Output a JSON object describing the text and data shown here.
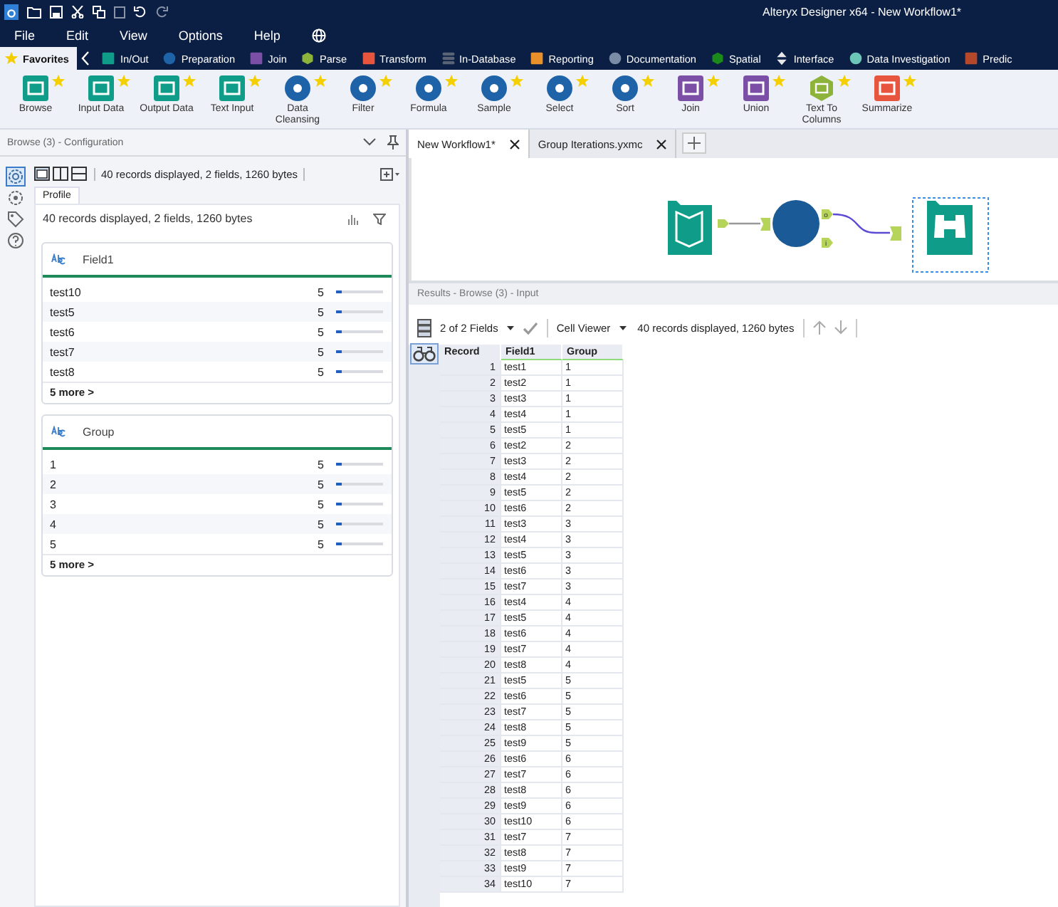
{
  "window": {
    "title": "Alteryx Designer x64 - New Workflow1*"
  },
  "menu": [
    "File",
    "Edit",
    "View",
    "Options",
    "Help"
  ],
  "categories": [
    {
      "label": "Favorites",
      "kind": "star",
      "color": "#f5cc00",
      "selected": true
    },
    {
      "label": "In/Out",
      "kind": "square",
      "color": "#0f9d8a",
      "selected": false
    },
    {
      "label": "Preparation",
      "kind": "circle",
      "color": "#1e63a8",
      "selected": false
    },
    {
      "label": "Join",
      "kind": "square",
      "color": "#7b4fa6",
      "selected": false
    },
    {
      "label": "Parse",
      "kind": "hexagon",
      "color": "#8db33a",
      "selected": false
    },
    {
      "label": "Transform",
      "kind": "square",
      "color": "#e8553e",
      "selected": false
    },
    {
      "label": "In-Database",
      "kind": "stack",
      "color": "#5a6375",
      "selected": false
    },
    {
      "label": "Reporting",
      "kind": "square",
      "color": "#e8902a",
      "selected": false
    },
    {
      "label": "Documentation",
      "kind": "circle",
      "color": "#7a8ba6",
      "selected": false
    },
    {
      "label": "Spatial",
      "kind": "hexagon",
      "color": "#1a8a1a",
      "selected": false
    },
    {
      "label": "Interface",
      "kind": "diamond",
      "color": "#e8e8e8",
      "selected": false
    },
    {
      "label": "Data Investigation",
      "kind": "circle",
      "color": "#6cc6b8",
      "selected": false
    },
    {
      "label": "Predic",
      "kind": "square",
      "color": "#b5482a",
      "selected": false
    }
  ],
  "tools": [
    {
      "label": "Browse",
      "kind": "square",
      "color": "#0f9d8a"
    },
    {
      "label": "Input Data",
      "kind": "square",
      "color": "#0f9d8a"
    },
    {
      "label": "Output Data",
      "kind": "square",
      "color": "#0f9d8a"
    },
    {
      "label": "Text Input",
      "kind": "square",
      "color": "#0f9d8a"
    },
    {
      "label": "Data Cleansing",
      "kind": "circle",
      "color": "#1e63a8"
    },
    {
      "label": "Filter",
      "kind": "circle",
      "color": "#1e63a8"
    },
    {
      "label": "Formula",
      "kind": "circle",
      "color": "#1e63a8"
    },
    {
      "label": "Sample",
      "kind": "circle",
      "color": "#1e63a8"
    },
    {
      "label": "Select",
      "kind": "circle",
      "color": "#1e63a8"
    },
    {
      "label": "Sort",
      "kind": "circle",
      "color": "#1e63a8"
    },
    {
      "label": "Join",
      "kind": "square",
      "color": "#7b4fa6"
    },
    {
      "label": "Union",
      "kind": "square",
      "color": "#7b4fa6"
    },
    {
      "label": "Text To Columns",
      "kind": "hexagon",
      "color": "#8db33a"
    },
    {
      "label": "Summarize",
      "kind": "square",
      "color": "#e8553e"
    }
  ],
  "config": {
    "title": "Browse (3) - Configuration",
    "toolbar_info": "40 records displayed, 2 fields, 1260 bytes",
    "tab": "Profile",
    "summary": "40 records displayed, 2 fields, 1260 bytes",
    "fields": [
      {
        "name": "Field1",
        "values": [
          {
            "value": "test10",
            "count": "5",
            "level": 0.125
          },
          {
            "value": "test5",
            "count": "5",
            "level": 0.125
          },
          {
            "value": "test6",
            "count": "5",
            "level": 0.125
          },
          {
            "value": "test7",
            "count": "5",
            "level": 0.125
          },
          {
            "value": "test8",
            "count": "5",
            "level": 0.125
          }
        ],
        "more": "5 more >"
      },
      {
        "name": "Group",
        "values": [
          {
            "value": "1",
            "count": "5",
            "level": 0.125
          },
          {
            "value": "2",
            "count": "5",
            "level": 0.125
          },
          {
            "value": "3",
            "count": "5",
            "level": 0.125
          },
          {
            "value": "4",
            "count": "5",
            "level": 0.125
          },
          {
            "value": "5",
            "count": "5",
            "level": 0.125
          }
        ],
        "more": "5 more >"
      }
    ]
  },
  "doc_tabs": [
    {
      "label": "New Workflow1*",
      "selected": true
    },
    {
      "label": "Group Iterations.yxmc",
      "selected": false
    }
  ],
  "canvas": {
    "anchors": [
      "o",
      "i"
    ],
    "browse_selected": true
  },
  "results": {
    "title": "Results - Browse (3) - Input",
    "fields": "2 of 2 Fields",
    "viewer": "Cell Viewer",
    "info": "40 records displayed, 1260 bytes",
    "columns": [
      "Record",
      "Field1",
      "Group"
    ],
    "rows": [
      [
        "1",
        "test1",
        "1"
      ],
      [
        "2",
        "test2",
        "1"
      ],
      [
        "3",
        "test3",
        "1"
      ],
      [
        "4",
        "test4",
        "1"
      ],
      [
        "5",
        "test5",
        "1"
      ],
      [
        "6",
        "test2",
        "2"
      ],
      [
        "7",
        "test3",
        "2"
      ],
      [
        "8",
        "test4",
        "2"
      ],
      [
        "9",
        "test5",
        "2"
      ],
      [
        "10",
        "test6",
        "2"
      ],
      [
        "11",
        "test3",
        "3"
      ],
      [
        "12",
        "test4",
        "3"
      ],
      [
        "13",
        "test5",
        "3"
      ],
      [
        "14",
        "test6",
        "3"
      ],
      [
        "15",
        "test7",
        "3"
      ],
      [
        "16",
        "test4",
        "4"
      ],
      [
        "17",
        "test5",
        "4"
      ],
      [
        "18",
        "test6",
        "4"
      ],
      [
        "19",
        "test7",
        "4"
      ],
      [
        "20",
        "test8",
        "4"
      ],
      [
        "21",
        "test5",
        "5"
      ],
      [
        "22",
        "test6",
        "5"
      ],
      [
        "23",
        "test7",
        "5"
      ],
      [
        "24",
        "test8",
        "5"
      ],
      [
        "25",
        "test9",
        "5"
      ],
      [
        "26",
        "test6",
        "6"
      ],
      [
        "27",
        "test7",
        "6"
      ],
      [
        "28",
        "test8",
        "6"
      ],
      [
        "29",
        "test9",
        "6"
      ],
      [
        "30",
        "test10",
        "6"
      ],
      [
        "31",
        "test7",
        "7"
      ],
      [
        "32",
        "test8",
        "7"
      ],
      [
        "33",
        "test9",
        "7"
      ],
      [
        "34",
        "test10",
        "7"
      ]
    ]
  }
}
